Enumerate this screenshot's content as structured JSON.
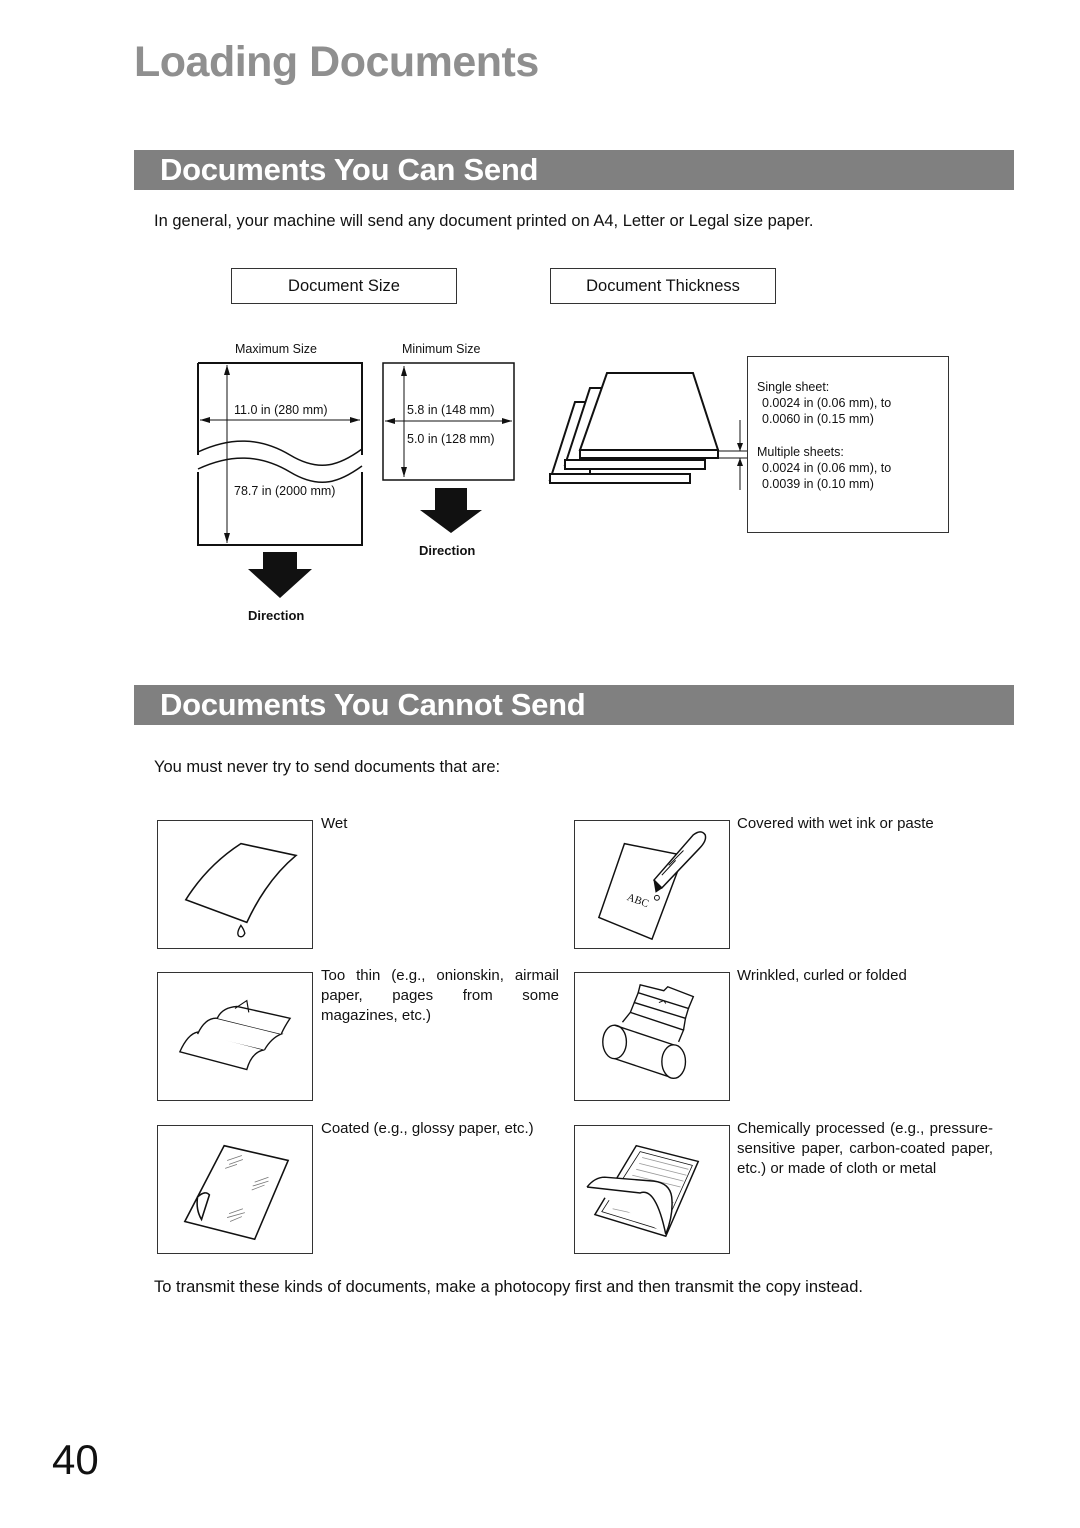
{
  "page": {
    "title": "Loading Documents",
    "page_number": "40"
  },
  "can_send": {
    "heading": "Documents You Can Send",
    "intro": "In general, your machine will send any document printed on A4, Letter or Legal size paper.",
    "size_box_label": "Document Size",
    "thickness_box_label": "Document Thickness",
    "max_size": {
      "label": "Maximum Size",
      "width": "11.0 in (280 mm)",
      "length": "78.7 in (2000 mm)",
      "direction": "Direction"
    },
    "min_size": {
      "label": "Minimum Size",
      "width": "5.8 in (148 mm)",
      "length": "5.0 in (128 mm)",
      "direction": "Direction"
    },
    "thickness": {
      "single_label": "Single sheet:",
      "single_min": "0.0024 in (0.06 mm), to",
      "single_max": "0.0060 in (0.15 mm)",
      "multiple_label": "Multiple sheets:",
      "multiple_min": "0.0024 in (0.06 mm), to",
      "multiple_max": "0.0039 in (0.10 mm)"
    }
  },
  "cannot_send": {
    "heading": "Documents You Cannot Send",
    "intro": "You must never try to send documents that are:",
    "items": [
      {
        "text": "Wet",
        "icon": "wet-paper-icon"
      },
      {
        "text": "Covered with wet ink or paste",
        "icon": "pen-ink-icon",
        "sample_text": "ABC"
      },
      {
        "text": "Too thin (e.g., onionskin, airmail paper, pages from some magazines, etc.)",
        "icon": "thin-paper-icon"
      },
      {
        "text": "Wrinkled, curled or folded",
        "icon": "wrinkled-paper-icon"
      },
      {
        "text": "Coated (e.g., glossy paper, etc.)",
        "icon": "coated-paper-icon"
      },
      {
        "text": "Chemically processed (e.g., pressure-sensitive paper, carbon-coated paper, etc.) or made of cloth or metal",
        "icon": "chemical-paper-icon"
      }
    ],
    "footer": "To transmit these kinds of documents, make a photocopy first and then transmit the copy instead."
  },
  "colors": {
    "section_bar": "#808080",
    "title": "#8f8f8f"
  }
}
